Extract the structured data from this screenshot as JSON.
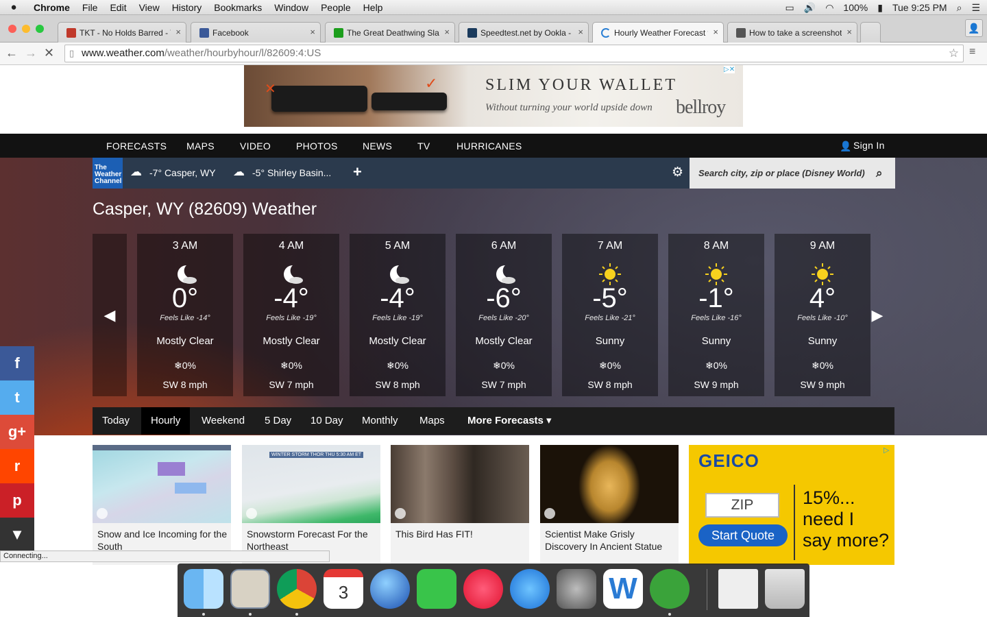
{
  "menubar": {
    "app": "Chrome",
    "items": [
      "File",
      "Edit",
      "View",
      "History",
      "Bookmarks",
      "Window",
      "People",
      "Help"
    ],
    "battery": "100%",
    "clock": "Tue 9:25 PM"
  },
  "tabs": [
    {
      "label": "TKT - No Holds Barred - T",
      "color": "#c0392b"
    },
    {
      "label": "Facebook",
      "color": "#3b5998"
    },
    {
      "label": "The Great Deathwing Slaye",
      "color": "#1c9e1c"
    },
    {
      "label": "Speedtest.net by Ookla - T",
      "color": "#1a3a5c"
    },
    {
      "label": "Hourly Weather Forecast fo",
      "color": "#2a7fd4"
    },
    {
      "label": "How to take a screenshot o",
      "color": "#555555"
    }
  ],
  "address": {
    "host": "www.weather.com",
    "path": "/weather/hourbyhour/l/82609:4:US"
  },
  "ad_top": {
    "headline": "SLIM YOUR WALLET",
    "tagline": "Without turning your world upside down",
    "brand": "bellroy"
  },
  "nav": {
    "items": [
      "FORECASTS",
      "MAPS",
      "VIDEO",
      "PHOTOS",
      "NEWS",
      "TV",
      "HURRICANES"
    ],
    "sign_in": "Sign In"
  },
  "locbar": {
    "logo_lines": [
      "The",
      "Weather",
      "Channel"
    ],
    "saved": [
      {
        "temp": "-7°",
        "place": "Casper, WY"
      },
      {
        "temp": "-5°",
        "place": "Shirley Basin..."
      }
    ],
    "add": "+",
    "search_placeholder": "Search city, zip or place (Disney World)"
  },
  "page_title": "Casper, WY (82609) Weather",
  "hourly": [
    {
      "time": "3 AM",
      "icon": "moon-icon",
      "temp": "0°",
      "feels": "Feels Like -14°",
      "cond": "Mostly Clear",
      "precip": "❄0%",
      "wind": "SW 8 mph"
    },
    {
      "time": "4 AM",
      "icon": "moon-icon",
      "temp": "-4°",
      "feels": "Feels Like -19°",
      "cond": "Mostly Clear",
      "precip": "❄0%",
      "wind": "SW 7 mph"
    },
    {
      "time": "5 AM",
      "icon": "moon-icon",
      "temp": "-4°",
      "feels": "Feels Like -19°",
      "cond": "Mostly Clear",
      "precip": "❄0%",
      "wind": "SW 8 mph"
    },
    {
      "time": "6 AM",
      "icon": "moon-icon",
      "temp": "-6°",
      "feels": "Feels Like -20°",
      "cond": "Mostly Clear",
      "precip": "❄0%",
      "wind": "SW 7 mph"
    },
    {
      "time": "7 AM",
      "icon": "sun-icon",
      "temp": "-5°",
      "feels": "Feels Like -21°",
      "cond": "Sunny",
      "precip": "❄0%",
      "wind": "SW 8 mph"
    },
    {
      "time": "8 AM",
      "icon": "sun-icon",
      "temp": "-1°",
      "feels": "Feels Like -16°",
      "cond": "Sunny",
      "precip": "❄0%",
      "wind": "SW 9 mph"
    },
    {
      "time": "9 AM",
      "icon": "sun-icon",
      "temp": "4°",
      "feels": "Feels Like -10°",
      "cond": "Sunny",
      "precip": "❄0%",
      "wind": "SW 9 mph"
    }
  ],
  "forecast_tabs": [
    "Today",
    "Hourly",
    "Weekend",
    "5 Day",
    "10 Day",
    "Monthly",
    "Maps",
    "More Forecasts ▾"
  ],
  "videos": [
    {
      "caption": "Snow and Ice Incoming for the South"
    },
    {
      "caption": "Snowstorm Forecast For the Northeast",
      "thumb_label": "WINTER STORM THOR   THU   5:30 AM ET"
    },
    {
      "caption": "This Bird Has FIT!"
    },
    {
      "caption": "Scientist Make Grisly Discovery In Ancient Statue"
    }
  ],
  "geico": {
    "brand": "GEICO",
    "zip": "ZIP",
    "button": "Start Quote",
    "line1": "15%...",
    "line2": "need I",
    "line3": "say more?"
  },
  "social": [
    "f",
    "t",
    "g+",
    "r",
    "p",
    "▼"
  ],
  "status": "Connecting...",
  "colors": {
    "accent": "#1c5fb4",
    "nav_bg": "#121212",
    "geico": "#f5c800"
  }
}
